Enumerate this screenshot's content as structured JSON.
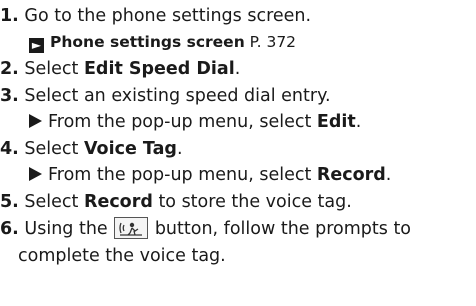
{
  "steps": [
    {
      "num": "1.",
      "text": "Go to the phone settings screen.",
      "ref": {
        "icon": "arrow-right-box-icon",
        "label": "Phone settings screen",
        "page": "P. 372"
      }
    },
    {
      "num": "2.",
      "pre": "Select ",
      "bold": "Edit Speed Dial",
      "post": "."
    },
    {
      "num": "3.",
      "text": "Select an existing speed dial entry.",
      "sub": {
        "pre": "From the pop-up menu, select ",
        "bold": "Edit",
        "post": "."
      }
    },
    {
      "num": "4.",
      "pre": "Select ",
      "bold": "Voice Tag",
      "post": ".",
      "sub": {
        "pre": "From the pop-up menu, select ",
        "bold": "Record",
        "post": "."
      }
    },
    {
      "num": "5.",
      "pre": "Select ",
      "bold": "Record",
      "post": " to store the voice tag."
    },
    {
      "num": "6.",
      "pre": "Using the ",
      "button_icon": "talk-button-icon",
      "post": " button, follow the prompts to",
      "cont": "complete the voice tag."
    }
  ]
}
